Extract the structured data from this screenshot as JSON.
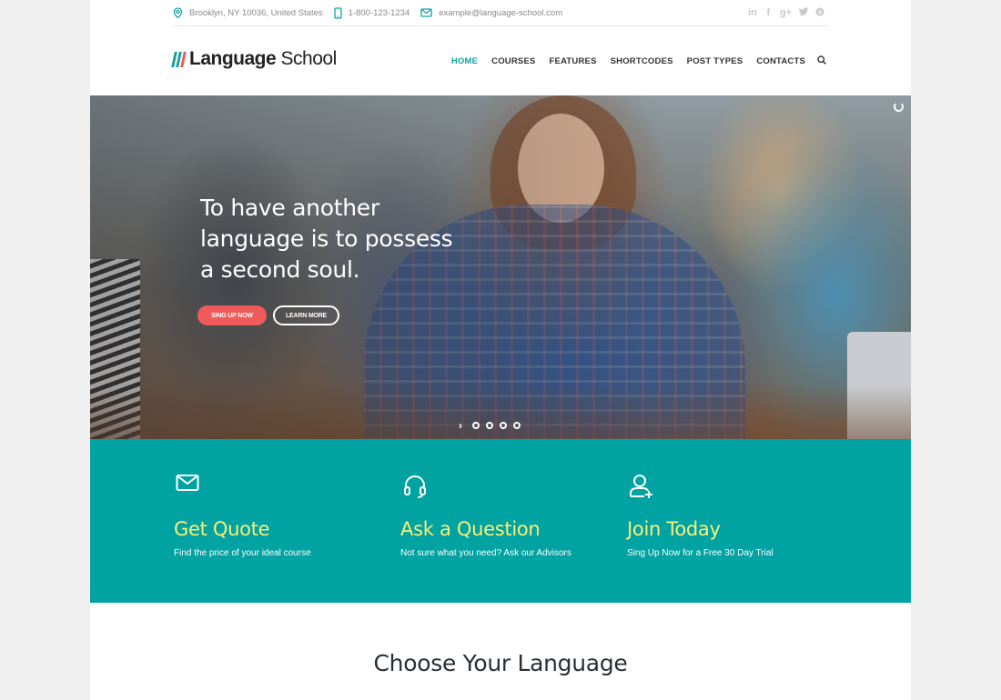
{
  "topbar": {
    "address": "Brooklyn, NY 10036, United States",
    "phone": "1-800-123-1234",
    "email": "example@language-school.com",
    "social": [
      {
        "icon": "linkedin-icon",
        "glyph": "in"
      },
      {
        "icon": "facebook-icon",
        "glyph": "f"
      },
      {
        "icon": "google-plus-icon",
        "glyph": "g+"
      },
      {
        "icon": "twitter-icon",
        "glyph": "🐦"
      },
      {
        "icon": "skype-icon",
        "glyph": "S"
      }
    ]
  },
  "header": {
    "logo_bold": "Language",
    "logo_light": " School",
    "logo_colors": [
      "#1a9f9f",
      "#1a9f9f",
      "#f15a5a"
    ],
    "nav": [
      {
        "label": "HOME",
        "active": true
      },
      {
        "label": "COURSES",
        "active": false
      },
      {
        "label": "FEATURES",
        "active": false
      },
      {
        "label": "SHORTCODES",
        "active": false
      },
      {
        "label": "POST TYPES",
        "active": false
      },
      {
        "label": "CONTACTS",
        "active": false
      }
    ],
    "search_icon": "search-icon"
  },
  "hero": {
    "title_lines": [
      "To have another",
      "language is to possess",
      "a second soul."
    ],
    "primary_button": "SING UP NOW",
    "secondary_button": "LEARN MORE",
    "slide_count": 4,
    "next_arrow": "›"
  },
  "features": [
    {
      "icon": "envelope-icon",
      "title": "Get Quote",
      "text": "Find the price of your ideal course"
    },
    {
      "icon": "headset-icon",
      "title": "Ask a Question",
      "text": "Not sure what you need? Ask our Advisors"
    },
    {
      "icon": "add-user-icon",
      "title": "Join Today",
      "text": "Sing Up Now for a Free 30 Day Trial"
    }
  ],
  "section": {
    "title": "Choose Your Language"
  },
  "colors": {
    "accent": "#00a2a2",
    "nav_active": "#10a3a3",
    "cta": "#f15a5a",
    "feature_title": "#f8f07a"
  }
}
